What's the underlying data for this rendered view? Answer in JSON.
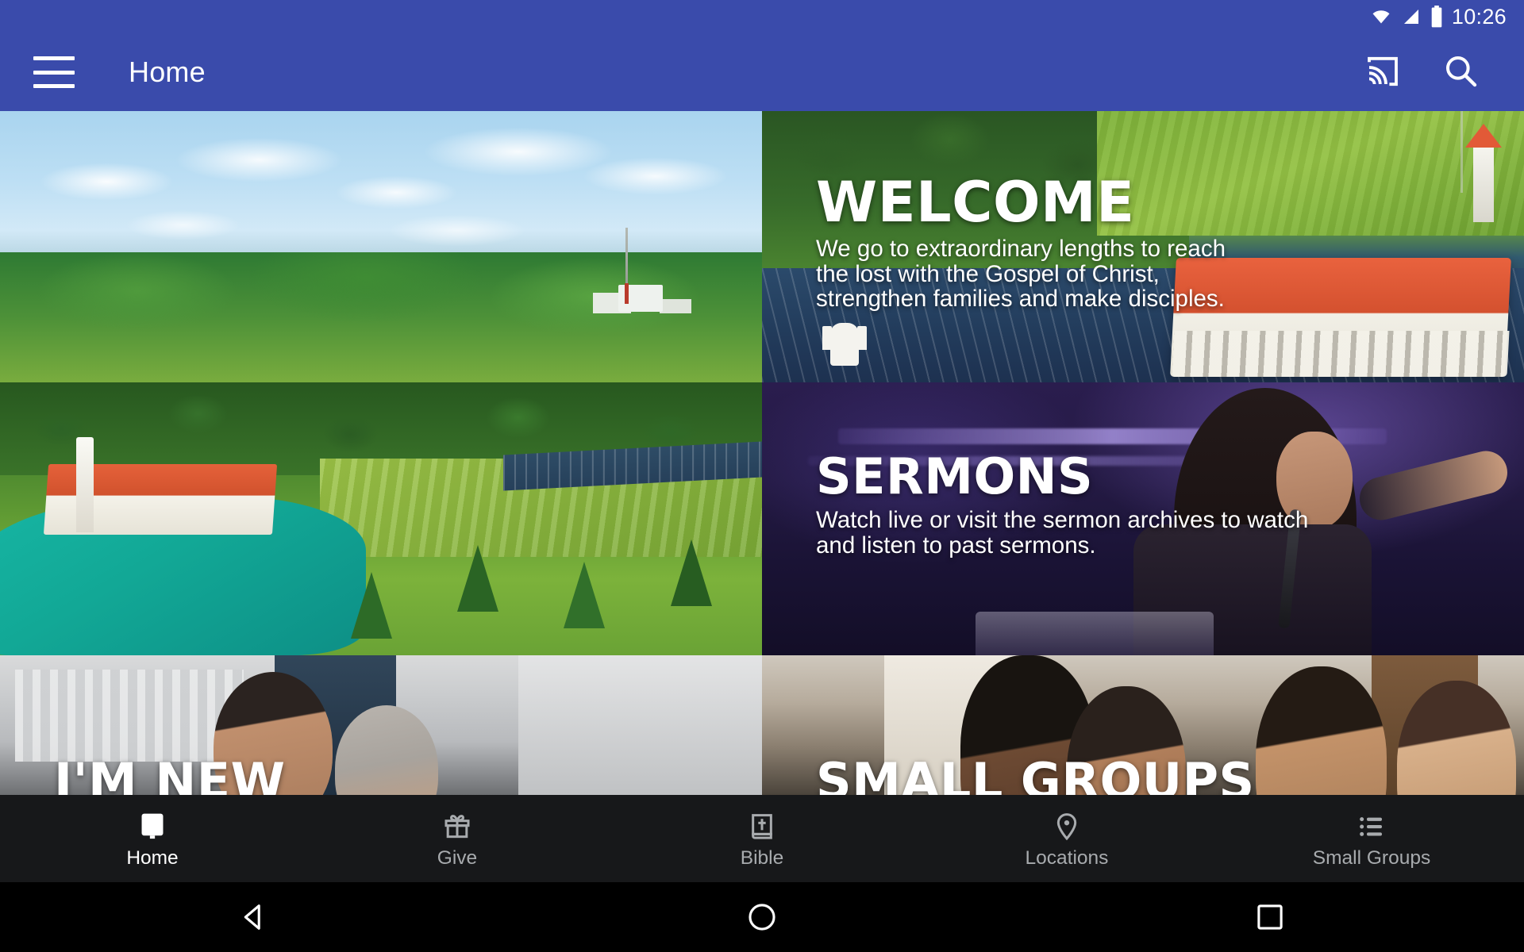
{
  "status_bar": {
    "time": "10:26",
    "icons": [
      "wifi-icon",
      "cell-signal-icon",
      "battery-icon"
    ]
  },
  "app_bar": {
    "title": "Home",
    "menu_icon": "hamburger-menu-icon",
    "cast_icon": "cast-icon",
    "search_icon": "search-icon",
    "background_color": "#3a4bab"
  },
  "tiles": [
    {
      "name": "aerial-landscape",
      "title": "",
      "description_lines": [],
      "image_alt": "Aerial view of rolling green countryside with clouds and a distant church with a radio mast"
    },
    {
      "name": "welcome",
      "title": "WELCOME",
      "description_lines": [
        "We go to extraordinary lengths to reach",
        "the lost with the Gospel of Christ,",
        "strengthen families and make disciples."
      ],
      "image_alt": "Aerial view of church campus with green fields, parking lot and statue"
    },
    {
      "name": "aerial-church-lake",
      "title": "",
      "description_lines": [],
      "image_alt": "Aerial view of a red-roofed church beside a turquoise lake surrounded by evergreens"
    },
    {
      "name": "sermons",
      "title": "SERMONS",
      "description_lines": [
        "Watch live or visit the sermon archives to watch",
        "and listen to past sermons."
      ],
      "image_alt": "Woman speaking into a microphone on a purple-lit stage"
    },
    {
      "name": "im-new",
      "title": "I'M NEW",
      "description_lines": [],
      "image_alt": "Two people on a city street"
    },
    {
      "name": "small-groups",
      "title": "SMALL GROUPS",
      "description_lines": [],
      "image_alt": "Group of people talking together indoors"
    }
  ],
  "bottom_nav": {
    "items": [
      {
        "label": "Home",
        "icon": "monitor-icon",
        "active": true
      },
      {
        "label": "Give",
        "icon": "gift-icon",
        "active": false
      },
      {
        "label": "Bible",
        "icon": "bible-icon",
        "active": false
      },
      {
        "label": "Locations",
        "icon": "map-pin-icon",
        "active": false
      },
      {
        "label": "Small Groups",
        "icon": "list-icon",
        "active": false
      }
    ],
    "active_color": "#ffffff",
    "inactive_color": "#a8abae",
    "background_color": "#17181a"
  },
  "system_nav": {
    "back_icon": "back-triangle-icon",
    "home_icon": "home-circle-icon",
    "recents_icon": "recents-square-icon"
  }
}
